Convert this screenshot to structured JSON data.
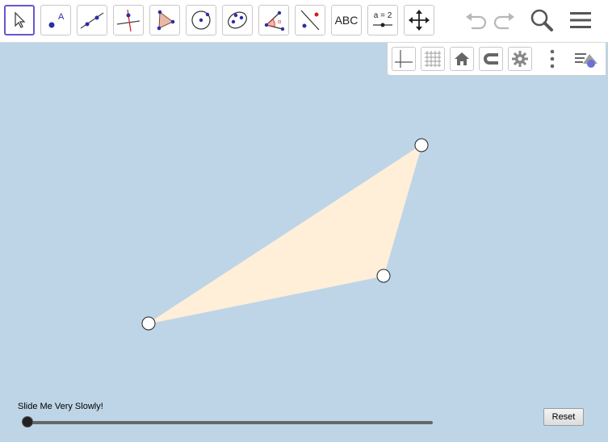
{
  "toolbar": {
    "tools": [
      {
        "name": "move",
        "icon": "cursor-arrow-icon",
        "selected": true
      },
      {
        "name": "point",
        "icon": "point-icon"
      },
      {
        "name": "line",
        "icon": "line-icon"
      },
      {
        "name": "perpendicular",
        "icon": "perpendicular-line-icon"
      },
      {
        "name": "polygon",
        "icon": "polygon-icon"
      },
      {
        "name": "circle",
        "icon": "circle-center-icon"
      },
      {
        "name": "ellipse",
        "icon": "ellipse-icon"
      },
      {
        "name": "angle",
        "icon": "angle-icon"
      },
      {
        "name": "reflect",
        "icon": "reflect-icon"
      },
      {
        "name": "text",
        "icon": "text-icon",
        "label": "ABC"
      },
      {
        "name": "slider",
        "icon": "slider-icon",
        "label": "a = 2"
      },
      {
        "name": "move-view",
        "icon": "move-graphics-icon"
      }
    ],
    "right": [
      "undo-icon",
      "redo-icon",
      "search-icon",
      "menu-icon"
    ]
  },
  "graphics_bar": [
    "axes-icon",
    "grid-icon",
    "home-icon",
    "magnet-icon",
    "gear-icon",
    "more-icon",
    "style-bar-icon"
  ],
  "colors": {
    "background": "#bdd5e7",
    "polygon_fill": "#ffeed8",
    "accent": "#6557d2",
    "point_fill": "#ffffff"
  },
  "slider": {
    "label": "Slide Me Very Slowly!",
    "value_fraction": 0.0
  },
  "reset_button": {
    "label": "Reset"
  }
}
